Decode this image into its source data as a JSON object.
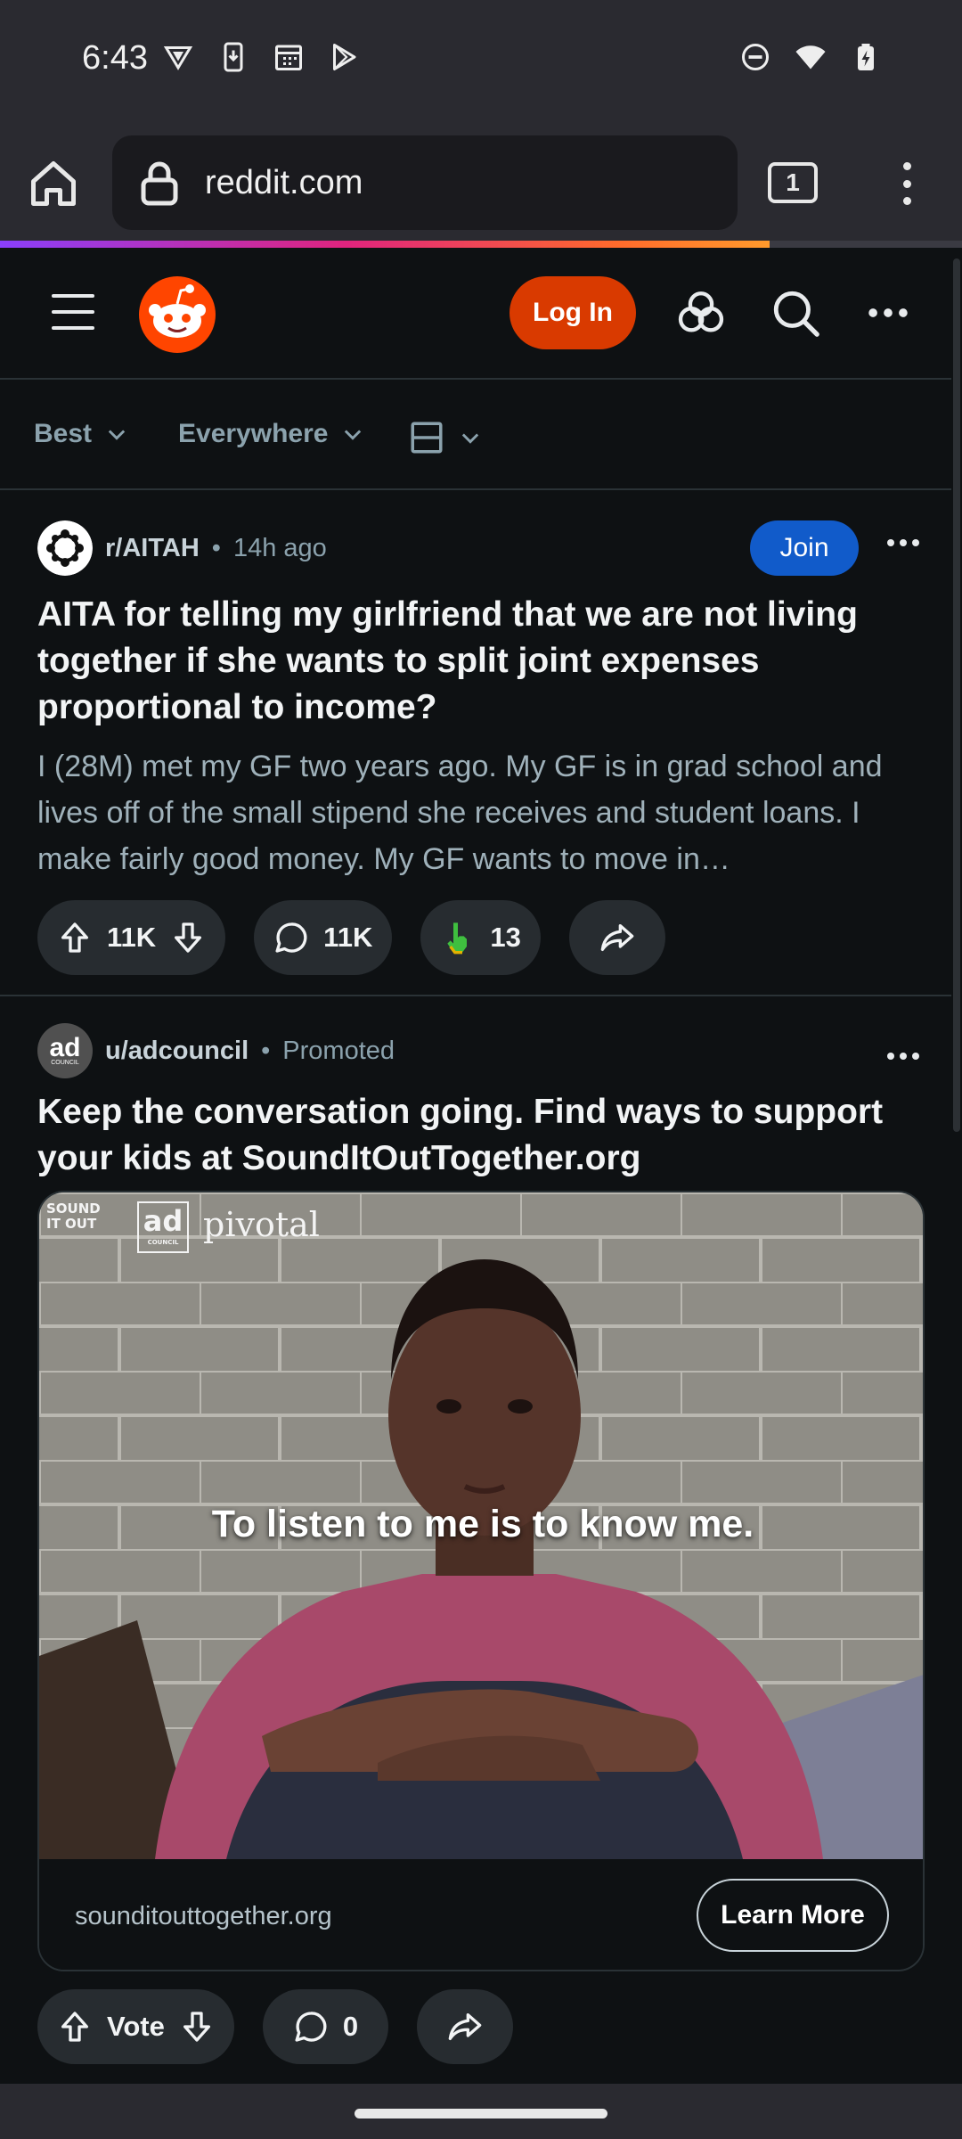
{
  "status_bar": {
    "time": "6:43",
    "left_icons": [
      "vpn-key-icon",
      "download-icon",
      "calendar-icon",
      "play-store-icon"
    ],
    "right_icons": [
      "do-not-disturb-icon",
      "wifi-icon",
      "battery-charging-icon"
    ]
  },
  "browser": {
    "url": "reddit.com",
    "tab_count": "1",
    "load_progress": 0.8
  },
  "reddit_header": {
    "login_label": "Log In"
  },
  "sort_bar": {
    "sort": "Best",
    "scope": "Everywhere"
  },
  "posts": [
    {
      "community": "r/AITAH",
      "separator": "•",
      "time": "14h ago",
      "join_label": "Join",
      "title": "AITA for telling my girlfriend that we are not living together if she wants to split joint expenses proportional to income?",
      "body": "I (28M) met my GF two years ago. My GF is in grad school and lives off of the small stipend she receives and student loans. I make fairly good money. My GF wants to move in…",
      "votes": "11K",
      "comments": "11K",
      "awards": "13"
    },
    {
      "author": "u/adcouncil",
      "separator": "•",
      "tag": "Promoted",
      "title": "Keep the conversation going. Find ways to support your kids at SoundItOutTogether.org",
      "image_caption": "To listen to me is to know me.",
      "logo_sound": "SOUND IT OUT",
      "logo_ad": "ad",
      "logo_council": "COUNCIL",
      "logo_pivotal": "pivotal",
      "avatar_text": "ad",
      "avatar_subtext": "COUNCIL",
      "domain": "sounditouttogether.org",
      "cta_label": "Learn More",
      "vote_label": "Vote",
      "comments": "0"
    }
  ],
  "colors": {
    "background": "#0e1113",
    "login": "#d93a00",
    "join": "#115bca",
    "pill": "#272c30"
  }
}
